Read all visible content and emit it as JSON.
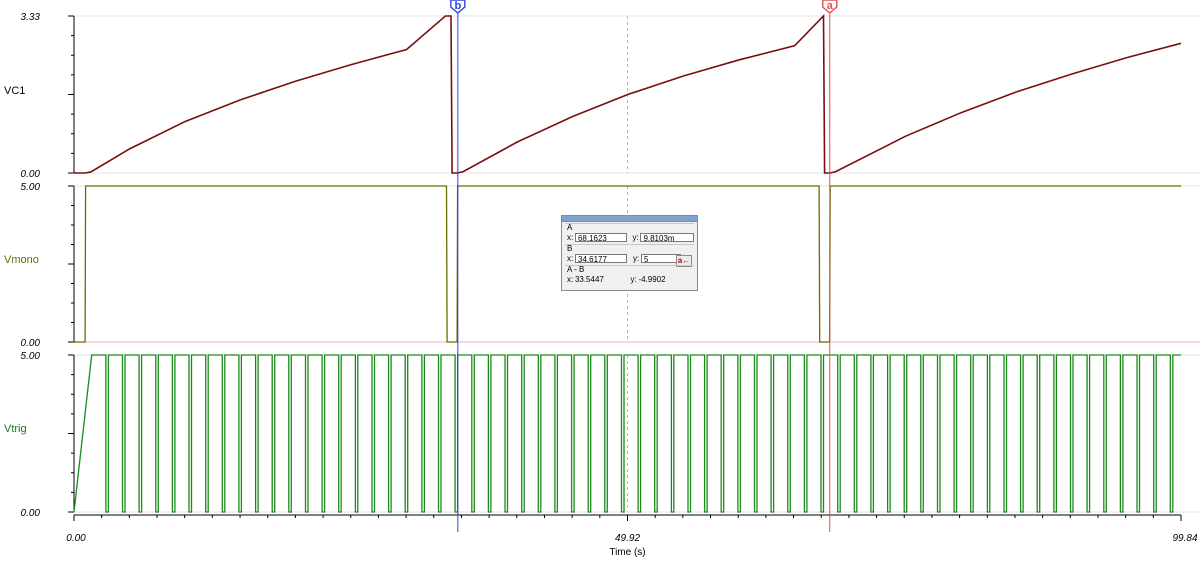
{
  "chart_data": {
    "type": "line",
    "x_label": "Time (s)",
    "x_ticks": [
      "0.00",
      "49.92",
      "99.84"
    ],
    "x_range": [
      0,
      99.84
    ],
    "panels": [
      {
        "name": "VC1",
        "y_ticks": [
          "0.00",
          "3.33"
        ],
        "y_range": [
          0,
          3.33
        ],
        "color": "#7a0e0e",
        "points": [
          [
            0,
            0
          ],
          [
            1.0,
            0
          ],
          [
            1.5,
            0.02
          ],
          [
            5,
            0.51
          ],
          [
            10,
            1.09
          ],
          [
            15,
            1.55
          ],
          [
            20,
            1.95
          ],
          [
            25,
            2.3
          ],
          [
            30,
            2.62
          ],
          [
            33.5,
            3.33
          ],
          [
            34.0,
            3.33
          ],
          [
            34.1,
            0
          ],
          [
            34.6,
            0
          ],
          [
            35.1,
            0.03
          ],
          [
            40,
            0.66
          ],
          [
            45,
            1.2
          ],
          [
            50,
            1.67
          ],
          [
            55,
            2.06
          ],
          [
            60,
            2.4
          ],
          [
            65,
            2.7
          ],
          [
            67.6,
            3.33
          ],
          [
            67.7,
            0
          ],
          [
            68.2,
            0
          ],
          [
            68.7,
            0.03
          ],
          [
            75,
            0.78
          ],
          [
            80,
            1.28
          ],
          [
            85,
            1.72
          ],
          [
            90,
            2.1
          ],
          [
            95,
            2.45
          ],
          [
            99.84,
            2.75
          ]
        ]
      },
      {
        "name": "Vmono",
        "y_ticks": [
          "0.00",
          "5.00"
        ],
        "y_range": [
          0,
          5
        ],
        "color": "#6b6b00",
        "points": [
          [
            0,
            0
          ],
          [
            1.0,
            0
          ],
          [
            1.05,
            5
          ],
          [
            33.6,
            5
          ],
          [
            33.65,
            0
          ],
          [
            34.55,
            0
          ],
          [
            34.6,
            5
          ],
          [
            67.2,
            5
          ],
          [
            67.25,
            0
          ],
          [
            68.15,
            0
          ],
          [
            68.2,
            5
          ],
          [
            99.84,
            5
          ]
        ]
      },
      {
        "name": "Vtrig",
        "y_ticks": [
          "0.00",
          "5.00"
        ],
        "y_range": [
          0,
          5
        ],
        "color": "#1a8a1a",
        "ramp_end_s": 1.6,
        "period_s": 1.5,
        "high_fraction": 0.85
      }
    ],
    "cursors": [
      {
        "name": "b",
        "x": 34.6177,
        "color": "#3344dd"
      },
      {
        "name": "a",
        "x": 68.1623,
        "color": "#e05050"
      }
    ],
    "center_gridline_x": 49.92
  },
  "readout": {
    "a_title": "A",
    "a_x_key": "x:",
    "a_x": "68.1623",
    "a_y_key": "y:",
    "a_y": "9.8103m",
    "b_title": "B",
    "b_x_key": "x:",
    "b_x": "34.6177",
    "b_y_key": "y:",
    "b_y": "5",
    "diff_title": "A - B",
    "diff_x_key": "x:",
    "diff_x": "33.5447",
    "diff_y_key": "y:",
    "diff_y": "-4.9902",
    "snap_label": "a←"
  }
}
